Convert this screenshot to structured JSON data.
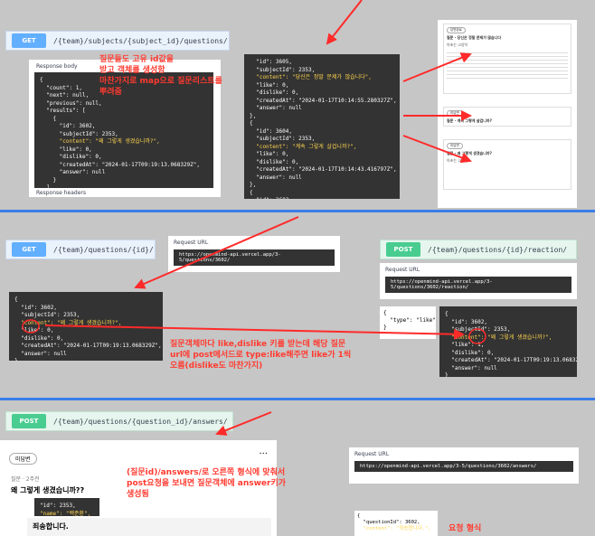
{
  "section1": {
    "method": "GET",
    "path": "/{team}/subjects/{subject_id}/questions/",
    "response_body_label": "Response body",
    "response_headers_label": "Response headers",
    "list_json": [
      "{",
      "  \"count\": 1,",
      "  \"next\": null,",
      "  \"previous\": null,",
      "  \"results\": [",
      "    {",
      "      \"id\": 3602,",
      "      \"subjectId\": 2353,",
      "      \"content\": \"왜 그렇게 생겼습니까?\",",
      "      \"like\": 0,",
      "      \"dislike\": 0,",
      "      \"createdAt\": \"2024-01-17T09:19:13.068329Z\",",
      "      \"answer\": null",
      "    }",
      "  ]",
      "}"
    ],
    "middle_json": [
      "  \"id\": 3605,",
      "  \"subjectId\": 2353,",
      "  \"content\": \"당신은 정말 문제가 많습니다\",",
      "  \"like\": 0,",
      "  \"dislike\": 0,",
      "  \"createdAt\": \"2024-01-17T10:14:55.280327Z\",",
      "  \"answer\": null",
      "},",
      "{",
      "  \"id\": 3604,",
      "  \"subjectId\": 2353,",
      "  \"content\": \"계속 그렇게 살겁니까?\",",
      "  \"like\": 0,",
      "  \"dislike\": 0,",
      "  \"createdAt\": \"2024-01-17T10:14:43.416797Z\",",
      "  \"answer\": null",
      "},",
      "{",
      "  \"id\": 3602,",
      "  \"subjectId\": 2353,",
      "  \"content\": \"왜 그렇게 생겼습니까?\","
    ],
    "note": "질문들도 고유 id값을\n받고 객체를 생성함\n마찬가지로 map으로 질문리스트를\n뿌려줌",
    "cards": [
      {
        "tag": "답변완료",
        "question": "질문 · 당신은 정말 문제가 많습니다",
        "name": "아초는 고양이"
      },
      {
        "tag": "미답변",
        "question": "질문 · 계속 그렇게 살겁니까?",
        "name": ""
      },
      {
        "tag": "미답변",
        "question": "질문 · 왜 그렇게 생겼습니까?",
        "name": "아초는 고양이"
      }
    ]
  },
  "section2": {
    "get_method": "GET",
    "get_path": "/{team}/questions/{id}/",
    "request_url_label": "Request URL",
    "get_url": "https://openmind-api.vercel.app/3-5/questions/3602/",
    "post_method": "POST",
    "post_path": "/{team}/questions/{id}/reaction/",
    "post_url": "https://openmind-api.vercel.app/3-5/questions/3602/reaction/",
    "body_json": [
      "{",
      "  \"type\": \"like\"",
      "}"
    ],
    "question_json": [
      "{",
      "  \"id\": 3602,",
      "  \"subjectId\": 2353,",
      "  \"content\": \"왜 그렇게 생겼습니까?\",",
      "  \"like\": 0,",
      "  \"dislike\": 0,",
      "  \"createdAt\": \"2024-01-17T09:19:13.068329Z\",",
      "  \"answer\": null",
      "}"
    ],
    "reacted_json": [
      "{",
      "  \"id\": 3602,",
      "  \"subjectId\": 2353,",
      "  \"content\": \"왜 그렇게 생겼습니까?\",",
      "  \"like\": 1,",
      "  \"dislike\": 0,",
      "  \"createdAt\": \"2024-01-17T09:19:13.068329Z\",",
      "  \"answer\": null",
      "}"
    ],
    "note": "질문객체마다 like,dislike 키를 받는데 해당 질문\nurl에 post메서드로 type:like해주면 like가 1씩\n오름(dislike도 마찬가지)"
  },
  "section3": {
    "method": "POST",
    "path": "/{team}/questions/{question_id}/answers/",
    "badge": "미답변",
    "more": "···",
    "question_meta": "질문 · 2주전",
    "question_title": "왜 그렇게 생겼습니까??",
    "snippet_json": [
      "\"id\": 2353,",
      "\"name\": \"백준환\","
    ],
    "answer_text": "죄송합니다.",
    "note": "(질문id)/answers/로 오른쪽 형식에 맞춰서\npost요청을 보내면 질문객체에 answer키가\n생성됨",
    "request_url_label": "Request URL",
    "post_url": "https://openmind-api.vercel.app/3-5/questions/3602/answers/",
    "body_json": [
      "{",
      "  \"questionId\": 3602,",
      "  \"content\": \"죄송합니다.\","
    ],
    "format_label": "요청 형식"
  }
}
